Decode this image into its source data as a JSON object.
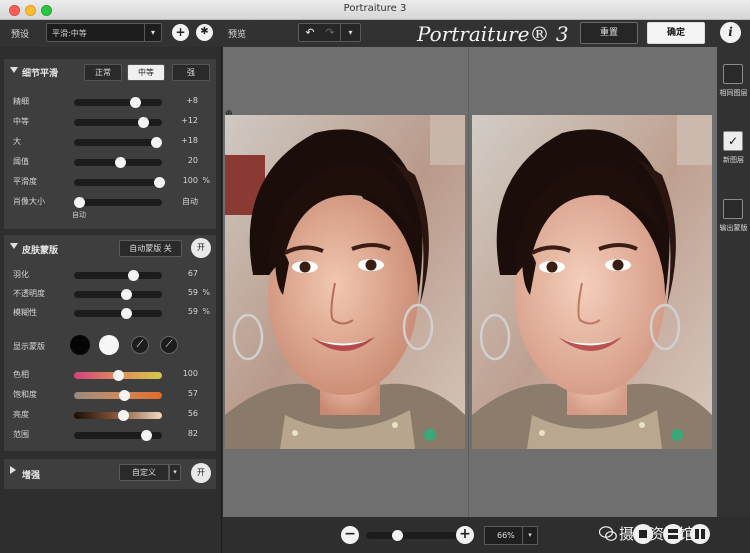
{
  "window": {
    "title": "Portraiture 3"
  },
  "toolbar": {
    "preset_label": "预设",
    "preset_value": "平滑:中等",
    "preview_label": "预览",
    "logo": "Portraiture® 3",
    "reset": "重置",
    "ok": "确定",
    "info": "i"
  },
  "detail_smoothing": {
    "title": "细节平滑",
    "modes": [
      "正常",
      "中等",
      "强"
    ],
    "active_mode": "中等",
    "sliders": [
      {
        "label": "精细",
        "value": "+8",
        "pos": 0.69
      },
      {
        "label": "中等",
        "value": "+12",
        "pos": 0.78
      },
      {
        "label": "大",
        "value": "+18",
        "pos": 0.93
      },
      {
        "label": "阈值",
        "value": "20",
        "pos": 0.52
      },
      {
        "label": "平滑度",
        "value": "100",
        "unit": "%",
        "pos": 0.97
      },
      {
        "label": "肖像大小",
        "value": "自动",
        "pos": 0.06
      }
    ],
    "auto_note": "自动"
  },
  "skin_mask": {
    "title": "皮肤蒙版",
    "auto_mask": "自动蒙版 关",
    "on": "开",
    "sliders": [
      {
        "label": "羽化",
        "value": "67",
        "pos": 0.67
      },
      {
        "label": "不透明度",
        "value": "59",
        "unit": "%",
        "pos": 0.59
      },
      {
        "label": "模糊性",
        "value": "59",
        "unit": "%",
        "pos": 0.59
      }
    ],
    "show_mask_label": "显示蒙版",
    "color_sliders": [
      {
        "label": "色相",
        "value": "100",
        "pos": 0.5,
        "gradient": "linear-gradient(90deg,#d0427e,#e08b5a,#d4c84a)"
      },
      {
        "label": "饱和度",
        "value": "57",
        "pos": 0.57,
        "gradient": "linear-gradient(90deg,#9a8a80,#cc8a60,#e26a2a)"
      },
      {
        "label": "亮度",
        "value": "56",
        "pos": 0.56,
        "gradient": "linear-gradient(90deg,#1a0e08,#8a5a3a,#f2d8c2)"
      },
      {
        "label": "范围",
        "value": "82",
        "pos": 0.82,
        "gradient": ""
      }
    ]
  },
  "enhance": {
    "title": "增强",
    "custom": "自定义",
    "on": "开"
  },
  "output_options": [
    {
      "label": "相同图层",
      "checked": false
    },
    {
      "label": "新图层",
      "checked": true
    },
    {
      "label": "输出蒙版",
      "checked": false
    }
  ],
  "bottom": {
    "zoom_value": "66%",
    "zoom_pos": 0.34,
    "watermark": "摄影资源馆"
  }
}
